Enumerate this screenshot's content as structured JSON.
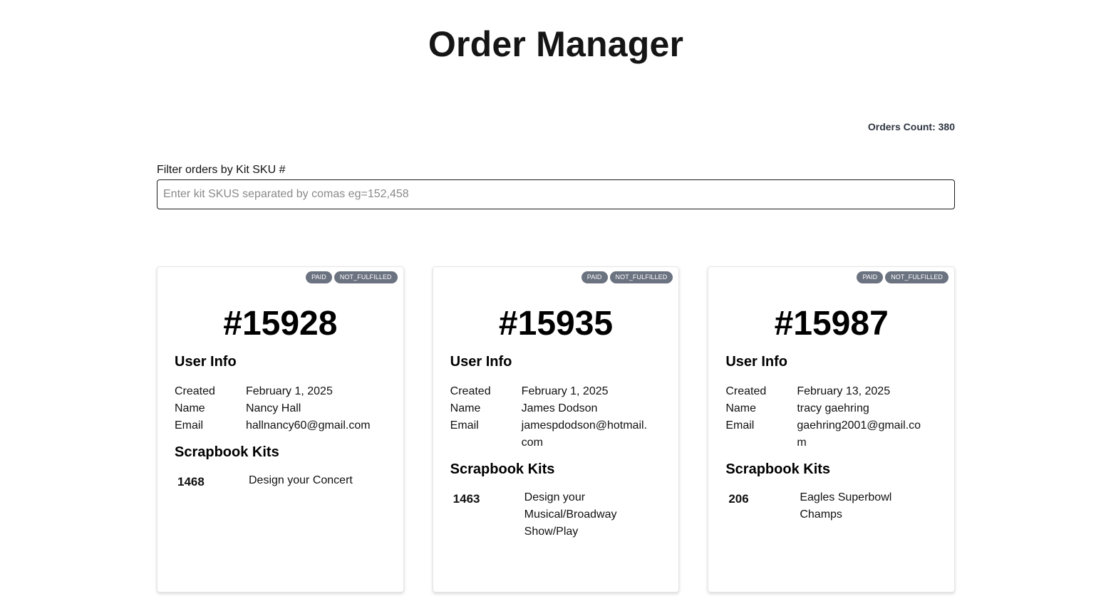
{
  "header": {
    "title": "Order Manager"
  },
  "orders_count": "Orders Count: 380",
  "filter": {
    "label": "Filter orders by Kit SKU #",
    "placeholder": "Enter kit SKUS separated by comas eg=152,458",
    "value": ""
  },
  "labels": {
    "user_info": "User Info",
    "scrapbook_kits": "Scrapbook Kits",
    "created": "Created",
    "name": "Name",
    "email": "Email"
  },
  "orders": [
    {
      "number": "#15928",
      "badges": [
        "PAID",
        "NOT_FULFILLED"
      ],
      "created": "February 1, 2025",
      "name": "Nancy Hall",
      "email": "hallnancy60@gmail.com",
      "kits": [
        {
          "sku": "1468",
          "name": "Design your Concert"
        }
      ]
    },
    {
      "number": "#15935",
      "badges": [
        "PAID",
        "NOT_FULFILLED"
      ],
      "created": "February 1, 2025",
      "name": "James Dodson",
      "email": "jamespdodson@hotmail.com",
      "kits": [
        {
          "sku": "1463",
          "name": "Design your Musical/Broadway Show/Play"
        }
      ]
    },
    {
      "number": "#15987",
      "badges": [
        "PAID",
        "NOT_FULFILLED"
      ],
      "created": "February 13, 2025",
      "name": "tracy gaehring",
      "email": "gaehring2001@gmail.com",
      "kits": [
        {
          "sku": "206",
          "name": "Eagles Superbowl Champs"
        }
      ]
    }
  ],
  "colors": {
    "badge_bg": "#6b7280",
    "orders_count_text": "#2d3440"
  }
}
